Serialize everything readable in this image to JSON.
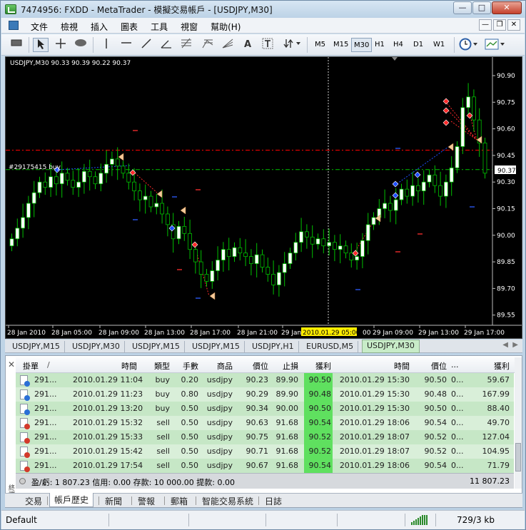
{
  "window": {
    "title": "7474956: FXDD - MetaTrader - 模擬交易帳戶 - [USDJPY,M30]",
    "min_label": "—",
    "max_label": "□",
    "close_label": "✕"
  },
  "menu": {
    "items": [
      "文件",
      "檢視",
      "插入",
      "圖表",
      "工具",
      "視窗",
      "幫助(H)"
    ],
    "mdi_min": "—",
    "mdi_restore": "❐",
    "mdi_close": "✕"
  },
  "toolbar": {
    "tools": [
      "rectangle-tool-icon",
      "cursor-icon",
      "crosshair-icon",
      "ellipse-icon",
      "vertical-line-icon",
      "horizontal-line-icon",
      "trendline-icon",
      "angle-icon",
      "fibonacci-icon",
      "fibo-expansion-icon",
      "fibo-fan-icon",
      "text-icon",
      "text-label-icon",
      "arrows-icon"
    ],
    "text_tool_label": "A",
    "timeframes": [
      "M5",
      "M15",
      "M30",
      "H1",
      "H4",
      "D1",
      "W1"
    ],
    "active_timeframe": "M30"
  },
  "chart": {
    "symbol_info": "USDJPY,M30  90.33 90.39 90.22 90.37",
    "order_label": "#29175415 buy",
    "current_price": "90.37",
    "highlight_time": "2010.01.29 05:00",
    "price_ticks": [
      "90.90",
      "90.75",
      "90.60",
      "90.45",
      "90.30",
      "90.15",
      "90.00",
      "89.85",
      "89.70",
      "89.55"
    ],
    "time_ticks": [
      "28 Jan 2010",
      "28 Jan 05:00",
      "28 Jan 09:00",
      "28 Jan 13:00",
      "28 Jan 17:00",
      "28 Jan 21:00",
      "29 Jan",
      "00",
      "29 Jan 09:00",
      "29 Jan 13:00",
      "29 Jan 17:00"
    ]
  },
  "chart_tabs": [
    "USDJPY,M15",
    "USDJPY,M30",
    "USDJPY,M15",
    "USDJPY,M15",
    "USDJPY,H1",
    "EURUSD,M5",
    "USDJPY,M30"
  ],
  "chart_tabs_active": 6,
  "terminal": {
    "headers": {
      "ticket": "掛單",
      "sort": "/",
      "time": "時間",
      "type": "類型",
      "size": "手數",
      "symbol": "商品",
      "price": "價位",
      "sl": "止損",
      "tp": "獲利",
      "close_time": "時間",
      "close_price": "價位",
      "more": "...",
      "profit": "獲利"
    },
    "rows": [
      {
        "ticket": "291...",
        "time": "2010.01.29 11:04",
        "type": "buy",
        "size": "0.20",
        "symbol": "usdjpy",
        "price": "90.23",
        "sl": "89.90",
        "tp": "90.50",
        "close_time": "2010.01.29 15:30",
        "close_price": "90.50",
        "more": "0...",
        "profit": "59.67",
        "dot": "#2a6fd6"
      },
      {
        "ticket": "291...",
        "time": "2010.01.29 11:23",
        "type": "buy",
        "size": "0.80",
        "symbol": "usdjpy",
        "price": "90.29",
        "sl": "89.90",
        "tp": "90.48",
        "close_time": "2010.01.29 15:30",
        "close_price": "90.48",
        "more": "0...",
        "profit": "167.99",
        "dot": "#2a6fd6"
      },
      {
        "ticket": "291...",
        "time": "2010.01.29 13:20",
        "type": "buy",
        "size": "0.50",
        "symbol": "usdjpy",
        "price": "90.34",
        "sl": "90.00",
        "tp": "90.50",
        "close_time": "2010.01.29 15:30",
        "close_price": "90.50",
        "more": "0...",
        "profit": "88.40",
        "dot": "#2a6fd6"
      },
      {
        "ticket": "291...",
        "time": "2010.01.29 15:32",
        "type": "sell",
        "size": "0.50",
        "symbol": "usdjpy",
        "price": "90.63",
        "sl": "91.68",
        "tp": "90.54",
        "close_time": "2010.01.29 18:06",
        "close_price": "90.54",
        "more": "0...",
        "profit": "49.70",
        "dot": "#d33a2a"
      },
      {
        "ticket": "291...",
        "time": "2010.01.29 15:33",
        "type": "sell",
        "size": "0.50",
        "symbol": "usdjpy",
        "price": "90.75",
        "sl": "91.68",
        "tp": "90.52",
        "close_time": "2010.01.29 18:07",
        "close_price": "90.52",
        "more": "0...",
        "profit": "127.04",
        "dot": "#d33a2a"
      },
      {
        "ticket": "291...",
        "time": "2010.01.29 15:42",
        "type": "sell",
        "size": "0.50",
        "symbol": "usdjpy",
        "price": "90.71",
        "sl": "91.68",
        "tp": "90.52",
        "close_time": "2010.01.29 18:07",
        "close_price": "90.52",
        "more": "0...",
        "profit": "104.95",
        "dot": "#d33a2a"
      },
      {
        "ticket": "291...",
        "time": "2010.01.29 17:54",
        "type": "sell",
        "size": "0.50",
        "symbol": "usdjpy",
        "price": "90.67",
        "sl": "91.68",
        "tp": "90.54",
        "close_time": "2010.01.29 18:06",
        "close_price": "90.54",
        "more": "0...",
        "profit": "71.79",
        "dot": "#d33a2a"
      }
    ],
    "summary": "盈/虧: 1 807.23  信用: 0.00  存款: 10 000.00  提款: 0.00",
    "summary_total": "11 807.23",
    "side_label": "終端",
    "close_label": "✕"
  },
  "terminal_tabs": [
    "交易",
    "帳戶歷史",
    "新聞",
    "警報",
    "郵箱",
    "智能交易系統",
    "日誌"
  ],
  "terminal_tabs_active": 1,
  "status": {
    "profile": "Default",
    "traffic": "729/3 kb"
  },
  "colors": {
    "bull_candle": "#ffffff",
    "bear_candle": "#000000",
    "candle_outline": "#00c000",
    "grid": "#1e2a1e",
    "axis_text": "#ffffff",
    "buy_marker": "#1f4fff",
    "sell_marker": "#ff2a2a",
    "tp_line": "#00c000",
    "sl_line": "#ff0000",
    "row_green": "#c6e7c6",
    "tp_highlight": "#5fe05f"
  }
}
